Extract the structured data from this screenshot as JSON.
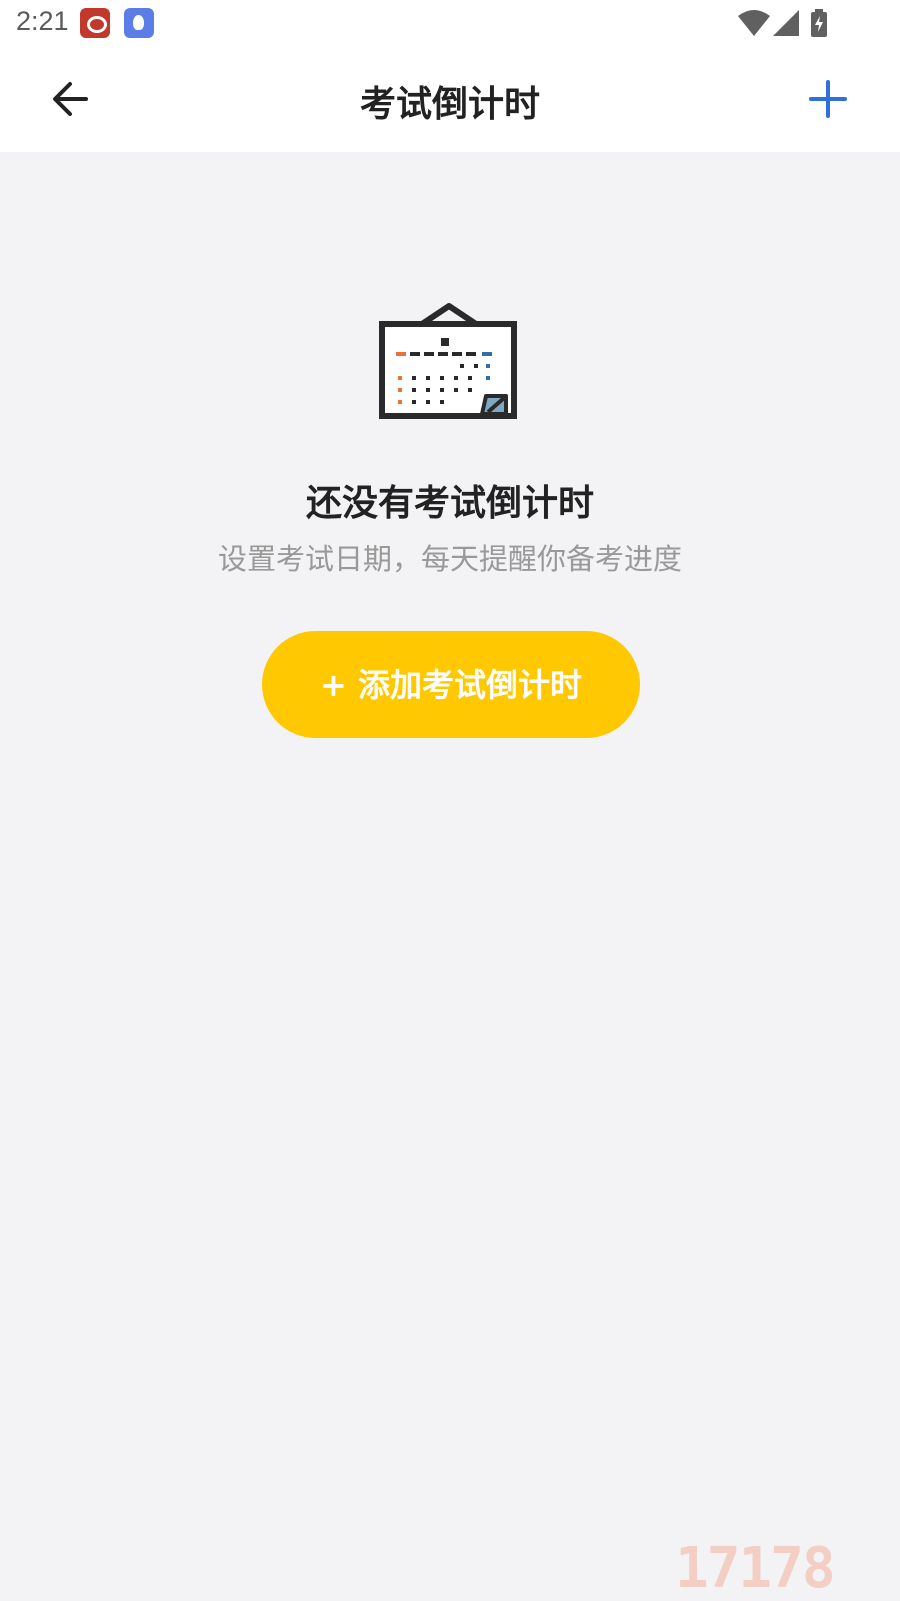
{
  "status_bar": {
    "time": "2:21",
    "notification_icons": [
      "weibo-icon",
      "bird-app-icon"
    ],
    "system_icons": [
      "wifi-icon",
      "signal-icon",
      "battery-charging-icon"
    ]
  },
  "app_bar": {
    "back_icon": "arrow-left-icon",
    "title": "考试倒计时",
    "add_icon": "plus-icon",
    "accent_color": "#2f6fe0"
  },
  "empty_state": {
    "icon": "calendar-icon",
    "title": "还没有考试倒计时",
    "subtitle": "设置考试日期，每天提醒你备考进度",
    "button_label": "+ 添加考试倒计时",
    "button_color": "#ffc800"
  },
  "watermark": {
    "text": "17178"
  }
}
